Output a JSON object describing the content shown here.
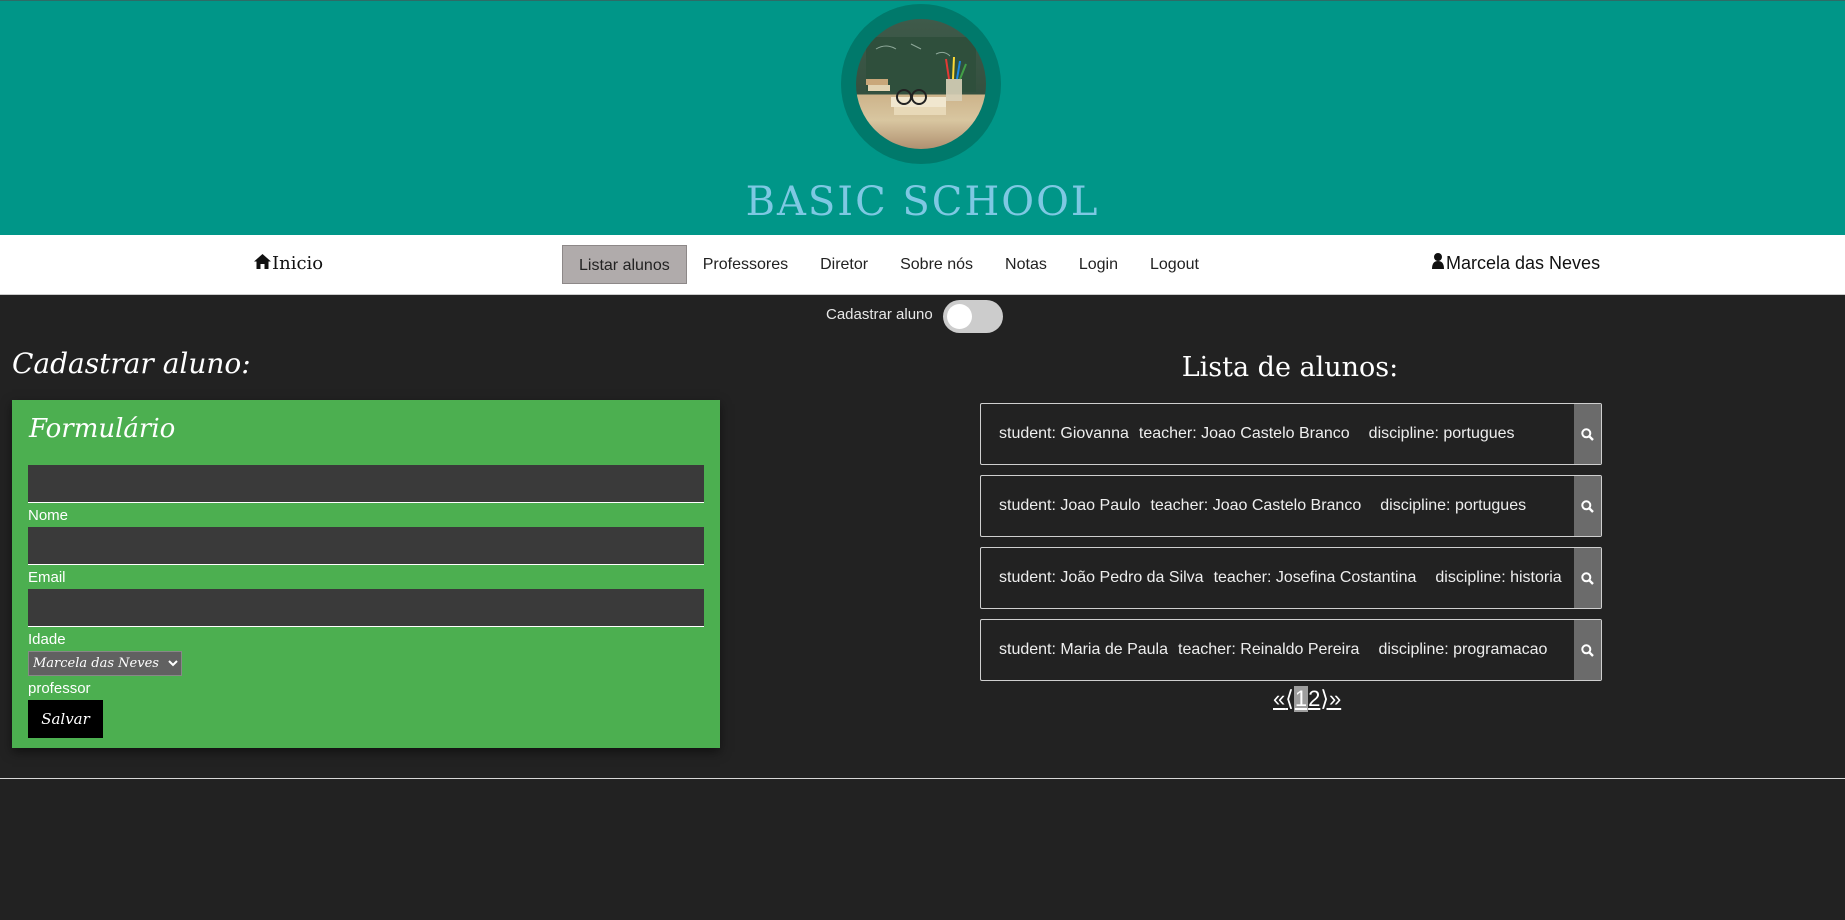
{
  "site": {
    "title": "BASIC SCHOOL",
    "logo": "school-desk-logo"
  },
  "nav": {
    "home_label": "Inicio",
    "home_icon": "home-icon",
    "links": [
      {
        "label": "Listar alunos",
        "active": true
      },
      {
        "label": "Professores",
        "active": false
      },
      {
        "label": "Diretor",
        "active": false
      },
      {
        "label": "Sobre nós",
        "active": false
      },
      {
        "label": "Notas",
        "active": false
      },
      {
        "label": "Login",
        "active": false
      },
      {
        "label": "Logout",
        "active": false
      }
    ],
    "user_name": "Marcela das Neves",
    "user_icon": "user-icon"
  },
  "toggle": {
    "label": "Cadastrar aluno",
    "on": false
  },
  "form": {
    "heading": "Cadastrar aluno:",
    "card_title": "Formulário",
    "name_label": "Nome",
    "email_label": "Email",
    "age_label": "Idade",
    "teacher_label": "professor",
    "teacher_selected": "Marcela das Neves",
    "save_label": "Salvar"
  },
  "students": {
    "heading": "Lista de alunos:",
    "items": [
      {
        "student": "student: Giovanna",
        "teacher": "teacher: Joao Castelo Branco",
        "discipline": "discipline: portugues"
      },
      {
        "student": "student: Joao Paulo",
        "teacher": "teacher: Joao Castelo Branco",
        "discipline": "discipline: portugues"
      },
      {
        "student": "student: João Pedro da Silva",
        "teacher": "teacher: Josefina Costantina",
        "discipline": "discipline: historia"
      },
      {
        "student": "student: Maria de Paula",
        "teacher": "teacher: Reinaldo Pereira",
        "discipline": "discipline: programacao"
      }
    ]
  },
  "pagination": {
    "first": "«",
    "prev": "⟨",
    "page1": "1",
    "page2": "2",
    "next": "⟩",
    "last": "»"
  },
  "colors": {
    "header": "#009688",
    "logo_ring": "#00796b",
    "form_card": "#4caf50",
    "background": "#222222"
  }
}
